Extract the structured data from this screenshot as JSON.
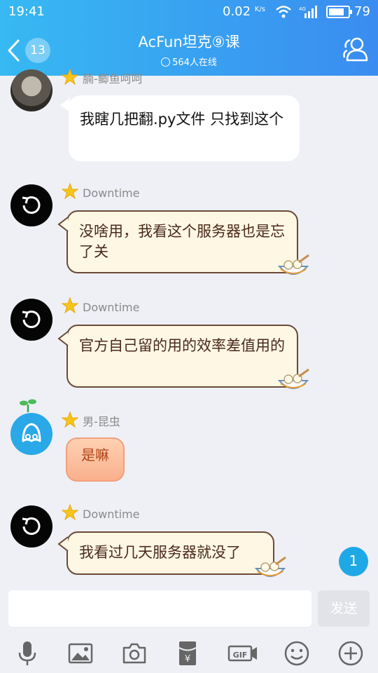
{
  "status_bar": {
    "time": "19:41",
    "net_speed": "0.02",
    "net_unit": "K/s",
    "net_type": "4G",
    "battery_percent": "79",
    "battery_level": 0.79
  },
  "header": {
    "back_count": "13",
    "title": "AcFun坦克⑨课",
    "online": "564人在线",
    "members_icon": "members-icon"
  },
  "messages": [
    {
      "sender": "腩-鲫鱼呵呵",
      "text": "我瞎几把翻.py文件 只找到这个",
      "style": "white"
    },
    {
      "sender": "Downtime",
      "text": "没啥用，我看这个服务器也是忘了关",
      "style": "cream"
    },
    {
      "sender": "Downtime",
      "text": "官方自己留的用的效率差值用的",
      "style": "cream"
    },
    {
      "sender": "男-昆虫",
      "text": "是嘛",
      "style": "peach"
    },
    {
      "sender": "Downtime",
      "text": "我看过几天服务器就没了",
      "style": "cream"
    }
  ],
  "unread_badge": "1",
  "composer": {
    "input_value": "",
    "send_label": "发送"
  },
  "toolbar": [
    "mic-icon",
    "image-icon",
    "camera-icon",
    "red-packet-icon",
    "gif-icon",
    "emoji-icon",
    "plus-icon"
  ],
  "colors": {
    "header_start": "#37b9f2",
    "header_end": "#3a8cf0",
    "accent": "#1fa8e6",
    "cream_bubble": "#fdf7e4"
  }
}
